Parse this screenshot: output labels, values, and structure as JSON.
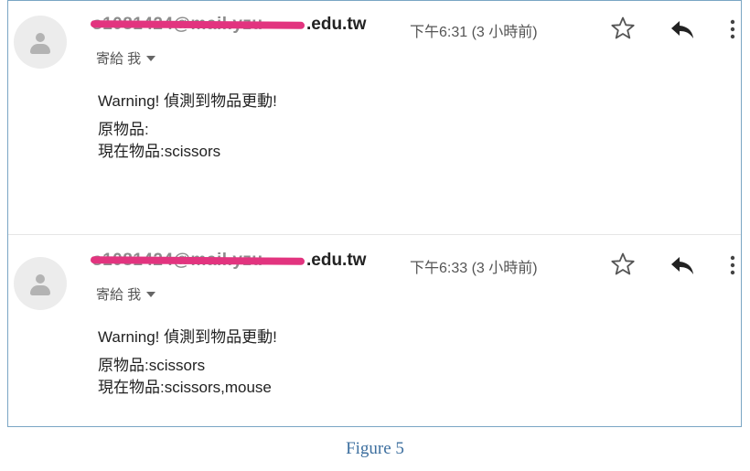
{
  "emails": [
    {
      "sender_visible": ".edu.tw",
      "to_label": "寄給 我",
      "time": "下午6:31 (3 小時前)",
      "body": [
        "Warning! 偵測到物品更動!",
        "原物品:",
        "現在物品:scissors"
      ]
    },
    {
      "sender_visible": ".edu.tw",
      "to_label": "寄給 我",
      "time": "下午6:33 (3 小時前)",
      "body": [
        "Warning! 偵測到物品更動!",
        "原物品:scissors",
        "現在物品:scissors,mouse"
      ]
    }
  ],
  "icons": {
    "avatar": "person-avatar-icon",
    "star": "star-icon",
    "reply": "reply-icon",
    "more": "more-vert-icon",
    "recipients": "caret-down-icon"
  },
  "colors": {
    "frame_border": "#7aa6c4",
    "redaction": "#e2347f",
    "caption": "#3d6f9f"
  },
  "caption": "Figure 5"
}
